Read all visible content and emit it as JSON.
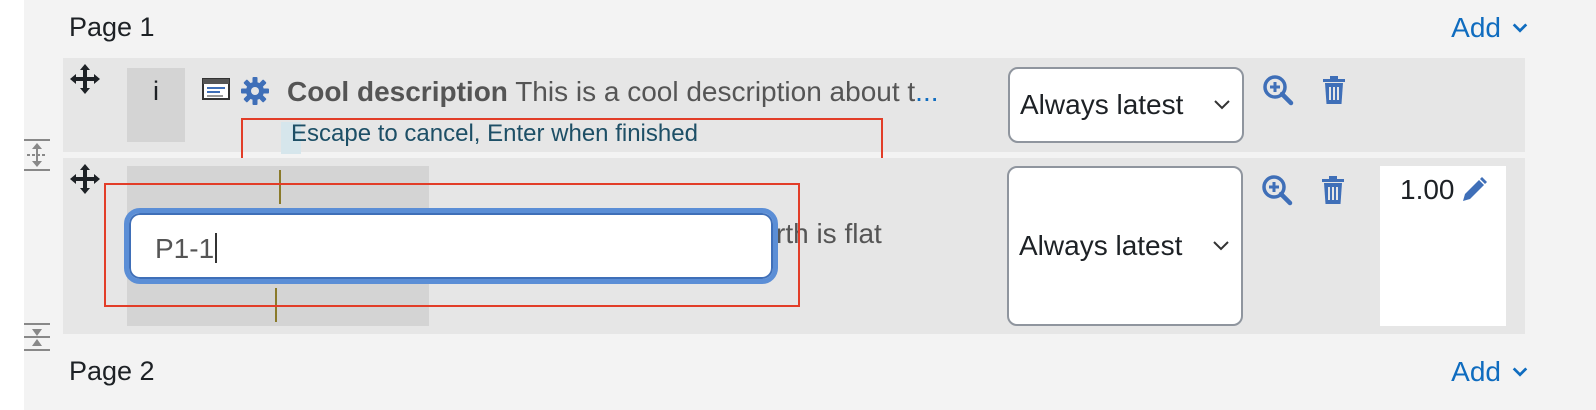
{
  "pages": [
    {
      "title": "Page 1",
      "add_label": "Add"
    },
    {
      "title": "Page 2",
      "add_label": "Add"
    }
  ],
  "slots": [
    {
      "number": "i",
      "name": "Cool description",
      "text": "This is a cool description about t",
      "ellipsis": "...",
      "hint": "Escape to cancel, Enter when finished",
      "version": "Always latest"
    },
    {
      "edit_value": "P1-1",
      "behind_text": "rth is flat",
      "version": "Always latest",
      "maxmark": "1.00"
    }
  ],
  "icons": {
    "move": "move-arrows-icon",
    "description_type": "description-type-icon",
    "settings": "gear-icon",
    "preview": "magnifier-plus-icon",
    "delete": "trash-icon",
    "edit": "pencil-icon",
    "page_break": "page-break-icon",
    "chevron": "chevron-down-icon"
  },
  "colors": {
    "link": "#0f6cbf",
    "highlight_border": "#e23d28",
    "focus_ring": "#5b8ed6"
  }
}
